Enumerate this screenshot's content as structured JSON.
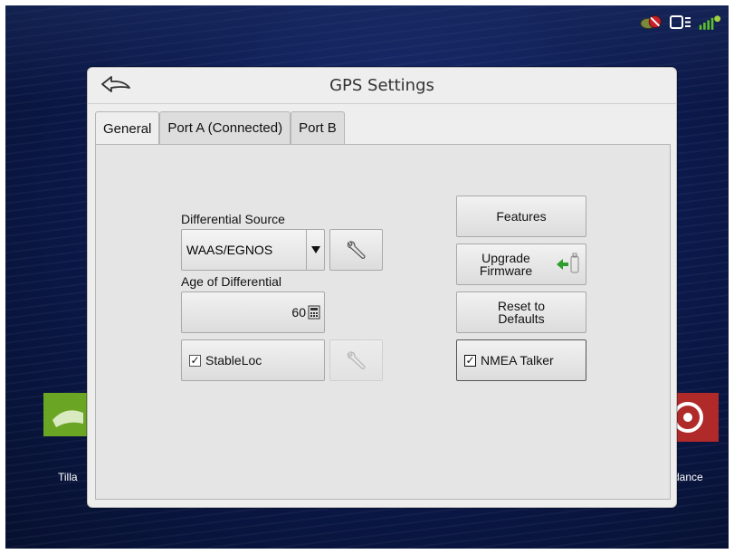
{
  "status_icons": [
    "antenna-icon",
    "display-icon",
    "gps-signal-icon"
  ],
  "background_tiles": {
    "left_label": "Tilla",
    "right_label": "dance"
  },
  "dialog": {
    "title": "GPS Settings",
    "tabs": [
      {
        "label": "General",
        "active": true
      },
      {
        "label": "Port A (Connected)",
        "active": false
      },
      {
        "label": "Port B",
        "active": false
      }
    ],
    "differential_source": {
      "label": "Differential Source",
      "value": "WAAS/EGNOS"
    },
    "age_of_differential": {
      "label": "Age of Differential",
      "value": "60"
    },
    "stableloc": {
      "label": "StableLoc",
      "checked": true
    },
    "buttons": {
      "features": "Features",
      "upgrade_firmware": "Upgrade\nFirmware",
      "reset_defaults": "Reset to\nDefaults",
      "nmea_talker": "NMEA Talker",
      "nmea_checked": true
    }
  },
  "colors": {
    "background_blue": "#0c1a4e",
    "dialog_bg": "#eeeeee",
    "tile_green": "#6aa524",
    "tile_red": "#b02a2a",
    "arrow_green": "#2e9d2e"
  }
}
